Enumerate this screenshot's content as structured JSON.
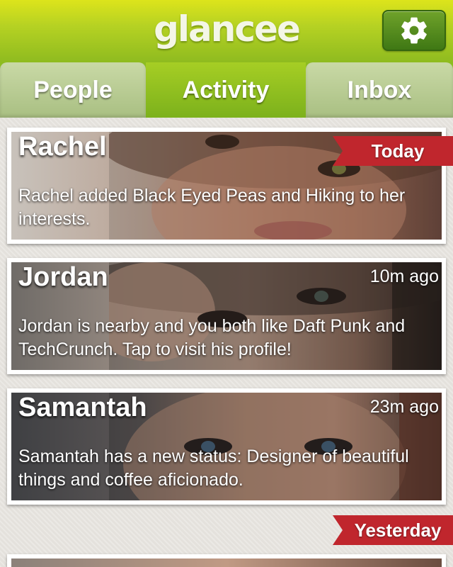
{
  "header": {
    "logo": "glancee",
    "settings_icon": "gear-icon"
  },
  "tabs": [
    {
      "label": "People",
      "active": false
    },
    {
      "label": "Activity",
      "active": true
    },
    {
      "label": "Inbox",
      "active": false
    }
  ],
  "ribbons": {
    "today": "Today",
    "yesterday": "Yesterday"
  },
  "activity": [
    {
      "name": "Rachel",
      "time": "",
      "text": "Rachel added Black Eyed Peas and Hiking to her interests."
    },
    {
      "name": "Jordan",
      "time": "10m ago",
      "text": "Jordan is nearby and you both like Daft Punk and TechCrunch. Tap to visit his profile!"
    },
    {
      "name": "Samantah",
      "time": "23m ago",
      "text": "Samantah has a new status: Designer of beautiful things and coffee aficionado."
    }
  ],
  "colors": {
    "brand_green": "#8dba1f",
    "ribbon_red": "#c0262d"
  }
}
